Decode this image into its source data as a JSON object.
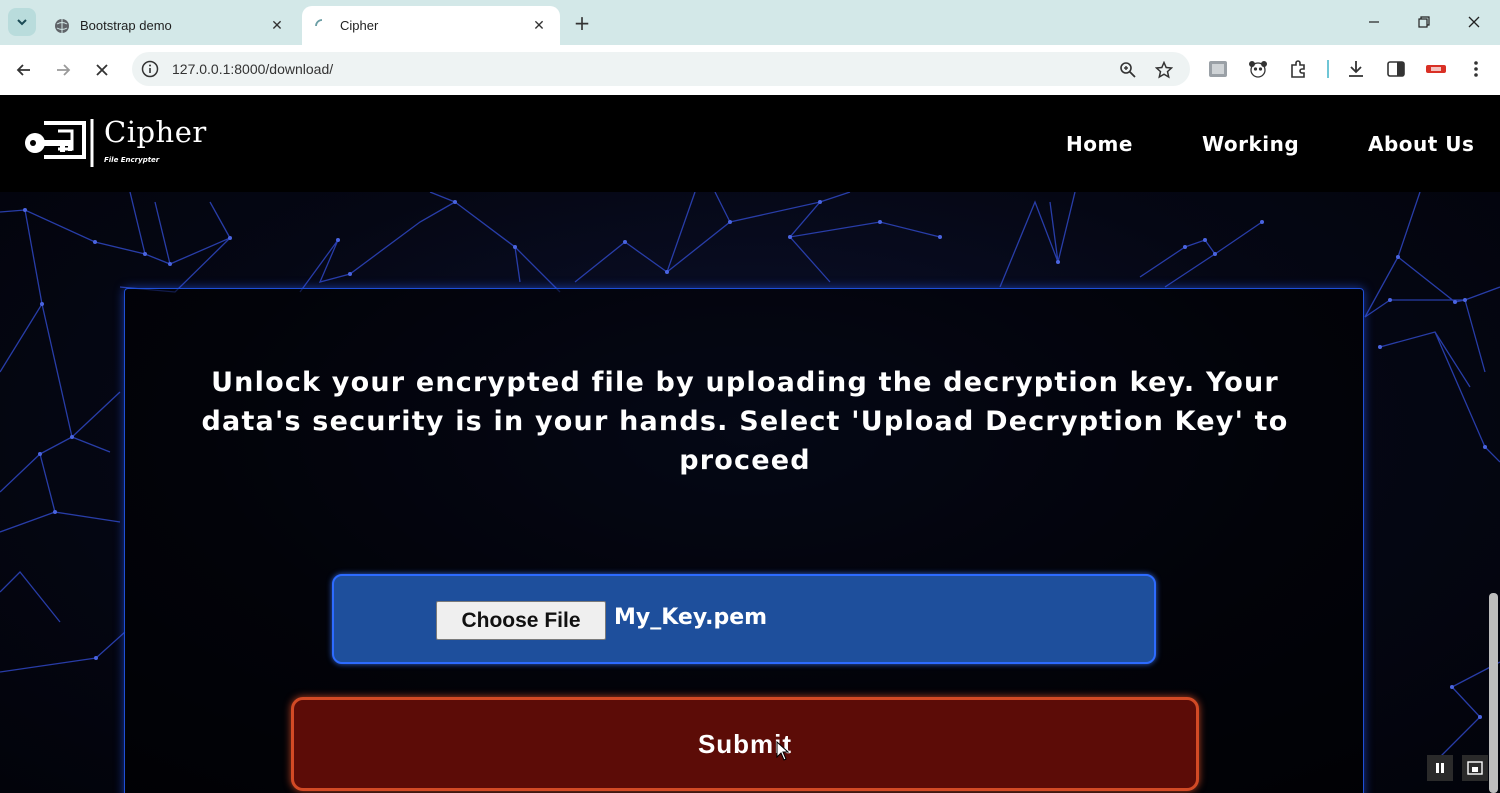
{
  "browser": {
    "tabs": [
      {
        "title": "Bootstrap demo",
        "favicon": "globe-icon",
        "active": false
      },
      {
        "title": "Cipher",
        "favicon": "loading-spinner-icon",
        "active": true
      }
    ],
    "url": "127.0.0.1:8000/download/"
  },
  "site": {
    "logo_name": "Cipher",
    "logo_tagline": "File Encrypter",
    "nav": [
      "Home",
      "Working",
      "About Us"
    ]
  },
  "main": {
    "message": "Unlock your encrypted file by uploading the decryption key. Your data's security is in your hands. Select 'Upload Decryption Key' to proceed",
    "choose_file_label": "Choose File",
    "file_name": "My_Key.pem",
    "submit_label": "Submit"
  },
  "colors": {
    "upload_bg": "#1e4f9c",
    "upload_border": "#2d6bff",
    "submit_bg": "#5c0c07",
    "submit_border": "#d24a25",
    "card_border": "#1e4fd6"
  }
}
